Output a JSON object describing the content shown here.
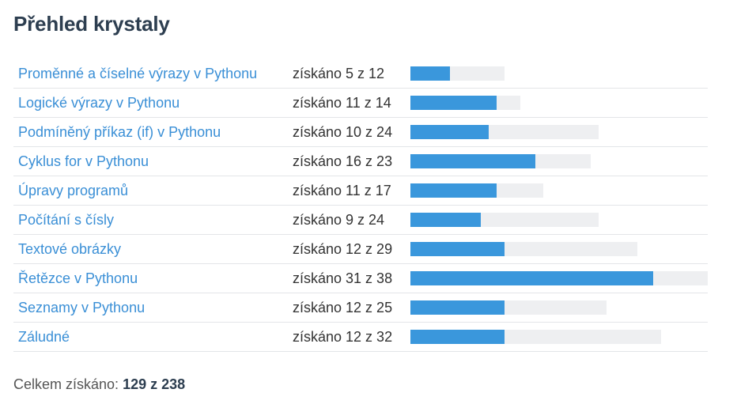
{
  "page": {
    "title": "Přehled krystaly"
  },
  "rows": [
    {
      "name": "Proměnné a číselné výrazy v Pythonu",
      "earned_text": "získáno 5 z 12",
      "earned": 5,
      "total": 12
    },
    {
      "name": "Logické výrazy v Pythonu",
      "earned_text": "získáno 11 z 14",
      "earned": 11,
      "total": 14
    },
    {
      "name": "Podmíněný příkaz (if) v Pythonu",
      "earned_text": "získáno 10 z 24",
      "earned": 10,
      "total": 24
    },
    {
      "name": "Cyklus for v Pythonu",
      "earned_text": "získáno 16 z 23",
      "earned": 16,
      "total": 23
    },
    {
      "name": "Úpravy programů",
      "earned_text": "získáno 11 z 17",
      "earned": 11,
      "total": 17
    },
    {
      "name": "Počítání s čísly",
      "earned_text": "získáno 9 z 24",
      "earned": 9,
      "total": 24
    },
    {
      "name": "Textové obrázky",
      "earned_text": "získáno 12 z 29",
      "earned": 12,
      "total": 29
    },
    {
      "name": "Řetězce v Pythonu",
      "earned_text": "získáno 31 z 38",
      "earned": 31,
      "total": 38
    },
    {
      "name": "Seznamy v Pythonu",
      "earned_text": "získáno 12 z 25",
      "earned": 12,
      "total": 25
    },
    {
      "name": "Záludné",
      "earned_text": "získáno 12 z 32",
      "earned": 12,
      "total": 32
    }
  ],
  "summary": {
    "label": "Celkem získáno:",
    "value": "129 z 238"
  },
  "colors": {
    "link": "#3a8fd6",
    "bar_fill": "#3a97dc",
    "bar_track": "#eeeff1",
    "title": "#2d3e50"
  }
}
